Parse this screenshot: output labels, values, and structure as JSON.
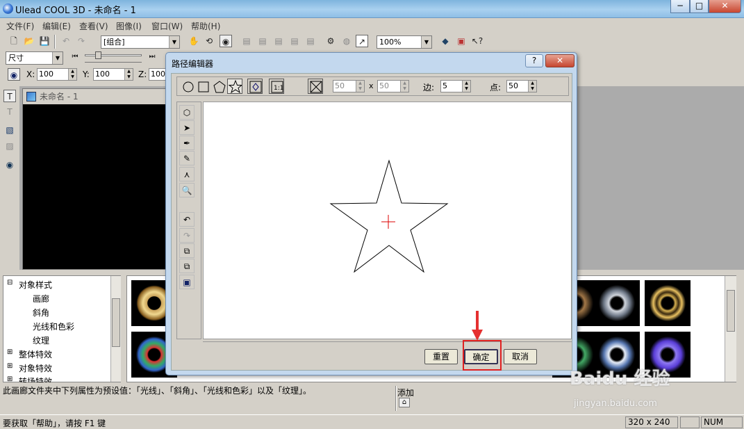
{
  "window": {
    "title": "Ulead COOL 3D - 未命名 - 1",
    "min": "−",
    "max": "□",
    "close": "✕"
  },
  "menu": [
    "文件(F)",
    "编辑(E)",
    "查看(V)",
    "图像(I)",
    "窗口(W)",
    "帮助(H)"
  ],
  "toolbar1": {
    "group_combo": "[组合]",
    "zoom_combo": "100%"
  },
  "toolbar2": {
    "size_combo": "尺寸"
  },
  "toolbar3": {
    "x_label": "X:",
    "x_value": "100",
    "y_label": "Y:",
    "y_value": "100",
    "z_label": "Z:",
    "z_value": "100"
  },
  "document": {
    "title": "未命名 - 1"
  },
  "tree": {
    "items": [
      {
        "label": "对象样式",
        "expander": "⊟"
      },
      {
        "label": "画廊"
      },
      {
        "label": "斜角"
      },
      {
        "label": "光线和色彩"
      },
      {
        "label": "纹理"
      },
      {
        "label": "整体特效",
        "expander": "⊞"
      },
      {
        "label": "对象特效",
        "expander": "⊞"
      },
      {
        "label": "转场特效",
        "expander": "⊞"
      }
    ]
  },
  "info_text": "此画廊文件夹中下列属性为预设值：「光线」、「斜角」、「光线和色彩」以及「纹理」。",
  "add_label": "添加",
  "statusbar": {
    "help": "要获取「帮助」，请按 F1 键",
    "size": "320 x 240",
    "num": "NUM"
  },
  "dialog": {
    "title": "路径编辑器",
    "help": "?",
    "close": "✕",
    "width_value": "50",
    "times": "x",
    "height_value": "50",
    "sides_label": "边:",
    "sides_value": "5",
    "points_label": "点:",
    "points_value": "50",
    "reset_button": "重置",
    "ok_button": "确定",
    "cancel_button": "取消"
  },
  "watermark": {
    "brand": "Baidu 经验",
    "url": "jingyan.baidu.com"
  }
}
